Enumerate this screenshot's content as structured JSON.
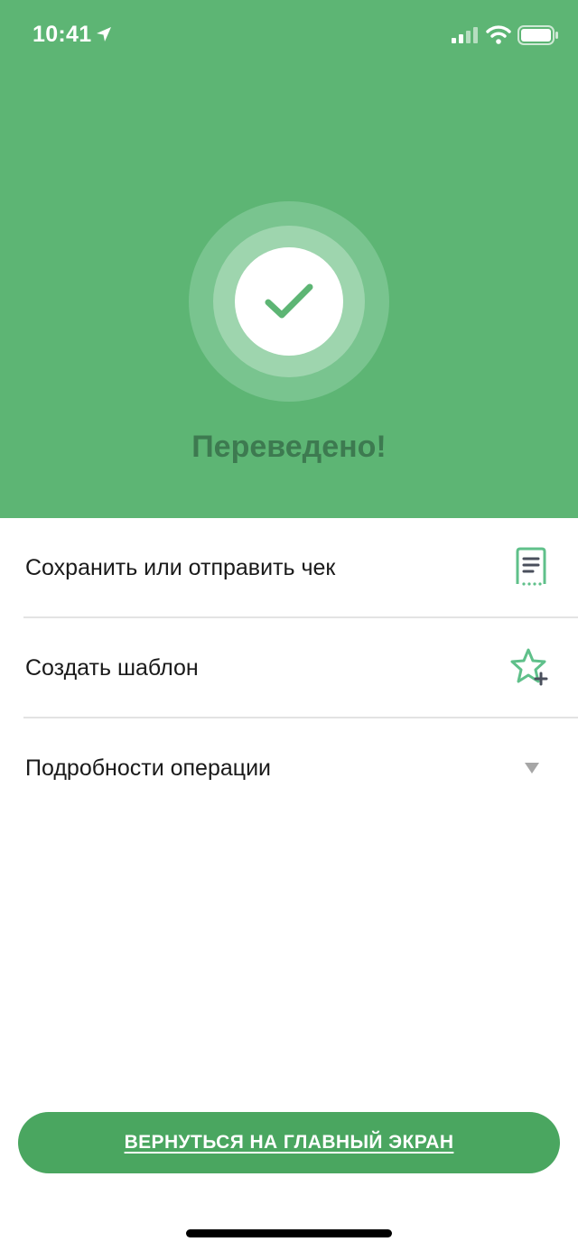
{
  "status_bar": {
    "time": "10:41",
    "icons": [
      "location-arrow-icon",
      "signal-icon",
      "wifi-icon",
      "battery-icon"
    ]
  },
  "hero": {
    "title": "Переведено!",
    "icon": "checkmark-icon"
  },
  "actions": [
    {
      "label": "Сохранить или отправить чек",
      "icon": "receipt-icon"
    },
    {
      "label": "Создать шаблон",
      "icon": "star-plus-icon"
    },
    {
      "label": "Подробности операции",
      "icon": "chevron-down-icon"
    }
  ],
  "footer": {
    "home_button_label": "ВЕРНУТЬСЯ НА ГЛАВНЫЙ ЭКРАН"
  },
  "colors": {
    "hero_bg": "#5db574",
    "title": "#3d7a50",
    "button": "#4aa660",
    "icon_accent": "#5fc08a"
  }
}
